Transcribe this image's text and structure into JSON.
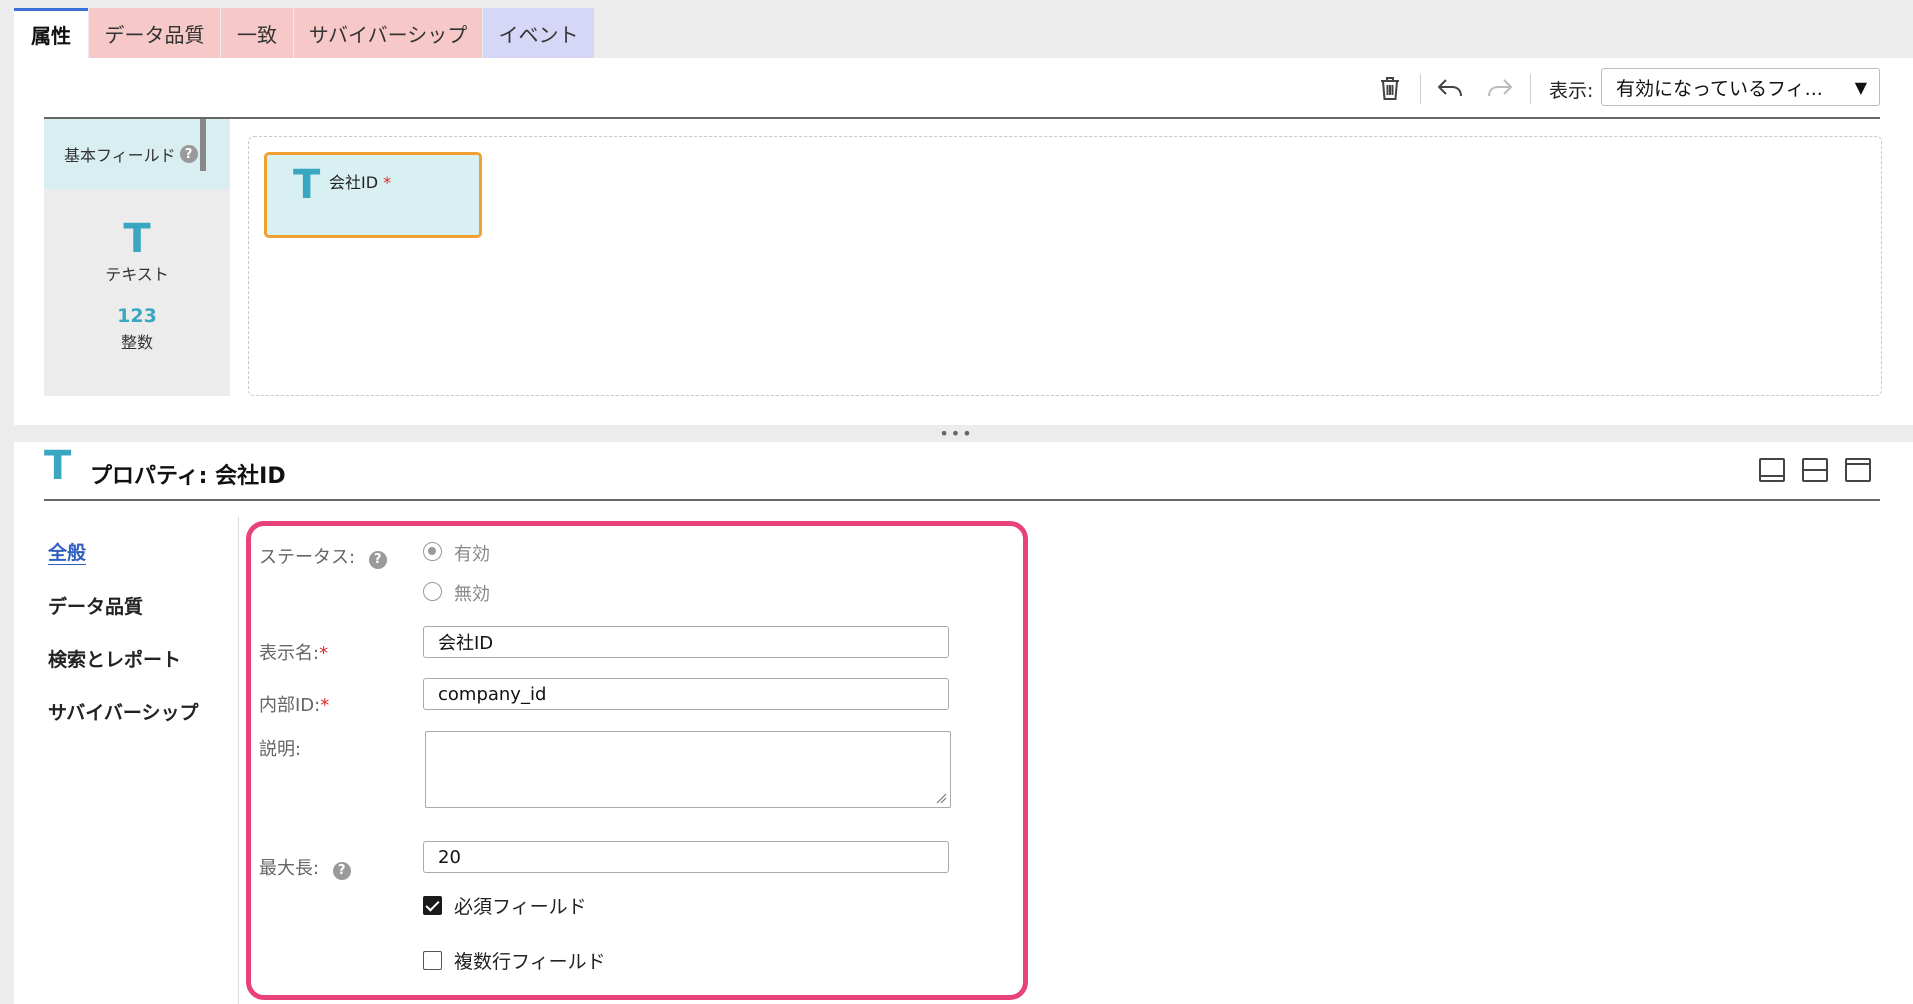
{
  "tabs": [
    {
      "label": "属性",
      "active": true
    },
    {
      "label": "データ品質"
    },
    {
      "label": "一致"
    },
    {
      "label": "サバイバーシップ"
    },
    {
      "label": "イベント"
    }
  ],
  "toolbar": {
    "icons": [
      "trash-icon",
      "undo-icon",
      "redo-icon"
    ],
    "view_label": "表示:",
    "view_select_value": "有効になっているフィ..."
  },
  "palette": {
    "header": "基本フィールド",
    "help": "?",
    "items": [
      {
        "glyph": "T",
        "label": "テキスト",
        "icon": "text-type-icon"
      },
      {
        "glyph": "123",
        "label": "整数",
        "icon": "integer-type-icon"
      }
    ]
  },
  "canvas": {
    "field": {
      "glyph": "T",
      "name": "会社ID",
      "required_mark": "*"
    }
  },
  "splitter": {
    "handle": "•••"
  },
  "properties": {
    "glyph": "T",
    "title": "プロパティ: 会社ID",
    "layout_icons": [
      "layout-bottom-icon",
      "layout-split-icon",
      "layout-top-icon"
    ],
    "nav": [
      {
        "label": "全般",
        "active": true
      },
      {
        "label": "データ品質"
      },
      {
        "label": "検索とレポート"
      },
      {
        "label": "サバイバーシップ"
      }
    ],
    "form": {
      "status_label": "ステータス:",
      "status_options": [
        {
          "label": "有効",
          "selected": true
        },
        {
          "label": "無効",
          "selected": false
        }
      ],
      "display_name_label": "表示名:",
      "display_name_value": "会社ID",
      "internal_id_label": "内部ID:",
      "internal_id_value": "company_id",
      "description_label": "説明:",
      "description_value": "",
      "max_length_label": "最大長:",
      "max_length_value": "20",
      "required_mark": "*",
      "help": "?",
      "required_field_label": "必須フィールド",
      "required_field_checked": true,
      "multiline_field_label": "複数行フィールド",
      "multiline_field_checked": false
    }
  },
  "colors": {
    "accent_teal": "#3aa7c2",
    "highlight_pink": "#e8427a",
    "selection_orange": "#f0a030",
    "tab_pink": "#f6c8c8",
    "tab_lavender": "#d6d6f6"
  }
}
